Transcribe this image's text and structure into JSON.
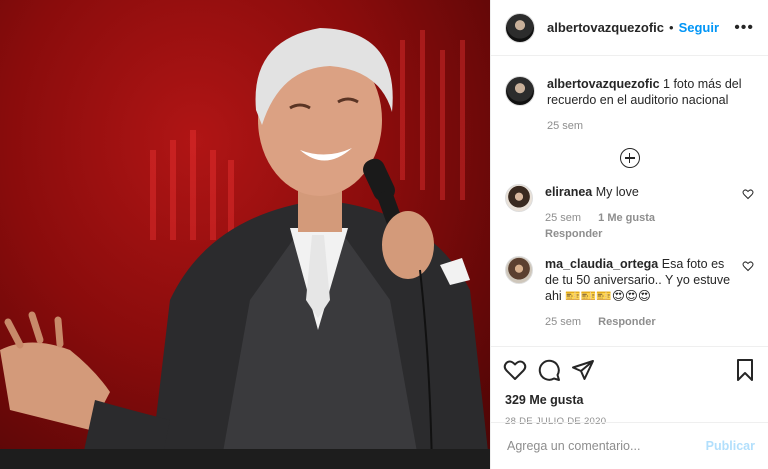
{
  "header": {
    "username": "albertovazquezofic",
    "separator": "•",
    "follow_label": "Seguir",
    "more_label": "•••"
  },
  "caption": {
    "username": "albertovazquezofic",
    "text": "1 foto más del recuerdo en el auditorio nacional",
    "time": "25 sem"
  },
  "comments": [
    {
      "username": "eliranea",
      "text": "My love",
      "time": "25 sem",
      "likes": "1 Me gusta",
      "reply": "Responder"
    },
    {
      "username": "ma_claudia_ortega",
      "text": "Esa foto es de tu 50 aniversario.. Y yo estuve ahi 🎫🎫🎫😍😍😍",
      "time": "25 sem",
      "reply": "Responder"
    }
  ],
  "footer": {
    "likes": "329 Me gusta",
    "date": "28 DE JULIO DE 2020",
    "comment_placeholder": "Agrega un comentario...",
    "publish_label": "Publicar"
  },
  "colors": {
    "accent": "#0095f6",
    "publish_disabled": "#b2dffc",
    "photo_red": "#b01515"
  },
  "icons": {
    "like": "heart-icon",
    "comment": "comment-icon",
    "share": "share-icon",
    "save": "bookmark-icon"
  }
}
